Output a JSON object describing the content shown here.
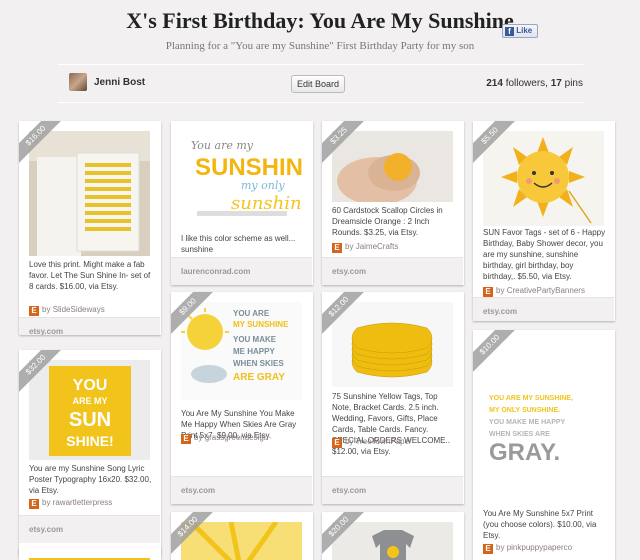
{
  "header": {
    "title": "X's First Birthday: You Are My Sunshine",
    "like_label": "Like",
    "subtitle": "Planning for a \"You are my Sunshine\" First Birthday Party for my son"
  },
  "board": {
    "user_name": "Jenni Bost",
    "edit_label": "Edit Board",
    "followers": "214",
    "followers_label": "followers,",
    "pins": "17",
    "pins_label": "pins"
  },
  "pins": [
    {
      "price": "$16.00",
      "desc": "Love this print. Might make a fab favor. Let The Sun Shine In- set of 8 cards. $16.00, via Etsy.",
      "via_prefix": "by",
      "source": "SlideSideways",
      "footer": "etsy.com",
      "art": [
        "LET",
        "THE SUN",
        "SHINE",
        "IN"
      ]
    },
    {
      "price": "$32.00",
      "desc": "You are my Sunshine Song Lyric Poster Typography 16x20. $32.00, via Etsy.",
      "via_prefix": "by",
      "source": "rawartletterpress",
      "footer": "etsy.com",
      "art": [
        "YOU",
        "ARE MY",
        "SUN",
        "SHINE!"
      ]
    },
    {
      "price": "",
      "desc": "I like this color scheme as well... sunshine",
      "via_prefix": "",
      "source": "",
      "footer": "laurenconrad.com",
      "art": [
        "You are my",
        "SUNSHINE",
        "my only",
        "sunshine"
      ]
    },
    {
      "price": "$9.00",
      "desc": "You Are My Sunshine You Make Me Happy When Skies Are Gray Print 5x7. $9.00, via Etsy.",
      "via_prefix": "by",
      "source": "grassgreendesign",
      "footer": "etsy.com",
      "art": [
        "YOU ARE",
        "MY SUNSHINE",
        "YOU MAKE",
        "ME HAPPY",
        "WHEN SKIES",
        "ARE GRAY"
      ]
    },
    {
      "price": "$3.25",
      "desc": "60 Cardstock Scallop Circles in Dreamsicle Orange : 2 Inch Rounds. $3.25, via Etsy.",
      "via_prefix": "by",
      "source": "JaimeCrafts",
      "footer": "etsy.com",
      "art": []
    },
    {
      "price": "$12.00",
      "desc": "75 Sunshine Yellow Tags, Top Note, Bracket Cards. 2.5 inch. Wedding, Favors, Gifts, Place Cards, Table Cards. Fancy. SPECIAL ORDERS WELCOME.. $12.00, via Etsy.",
      "via_prefix": "by",
      "source": "TreeTownPaper",
      "footer": "etsy.com",
      "art": []
    },
    {
      "price": "$5.50",
      "desc": "SUN Favor Tags - set of 6 - Happy Birthday, Baby Shower decor, you are my sunshine, sunshine birthday, girl birthday, boy birthday,. $5.50, via Etsy.",
      "via_prefix": "by",
      "source": "CreativePartyBanners",
      "footer": "etsy.com",
      "art": []
    },
    {
      "price": "$10.00",
      "desc": "You Are My Sunshine 5x7 Print (you choose colors). $10.00, via Etsy.",
      "via_prefix": "by",
      "source": "pinkpuppypaperco",
      "footer": "",
      "art": [
        "YOU ARE MY SUNSHINE,",
        "MY ONLY SUNSHINE.",
        "YOU MAKE ME HAPPY",
        "WHEN SKIES ARE",
        "GRAY."
      ]
    },
    {
      "price": "$14.00",
      "desc": "",
      "via_prefix": "",
      "source": "",
      "footer": "",
      "art": []
    },
    {
      "price": "$20.00",
      "desc": "",
      "via_prefix": "",
      "source": "",
      "footer": "",
      "art": []
    }
  ]
}
